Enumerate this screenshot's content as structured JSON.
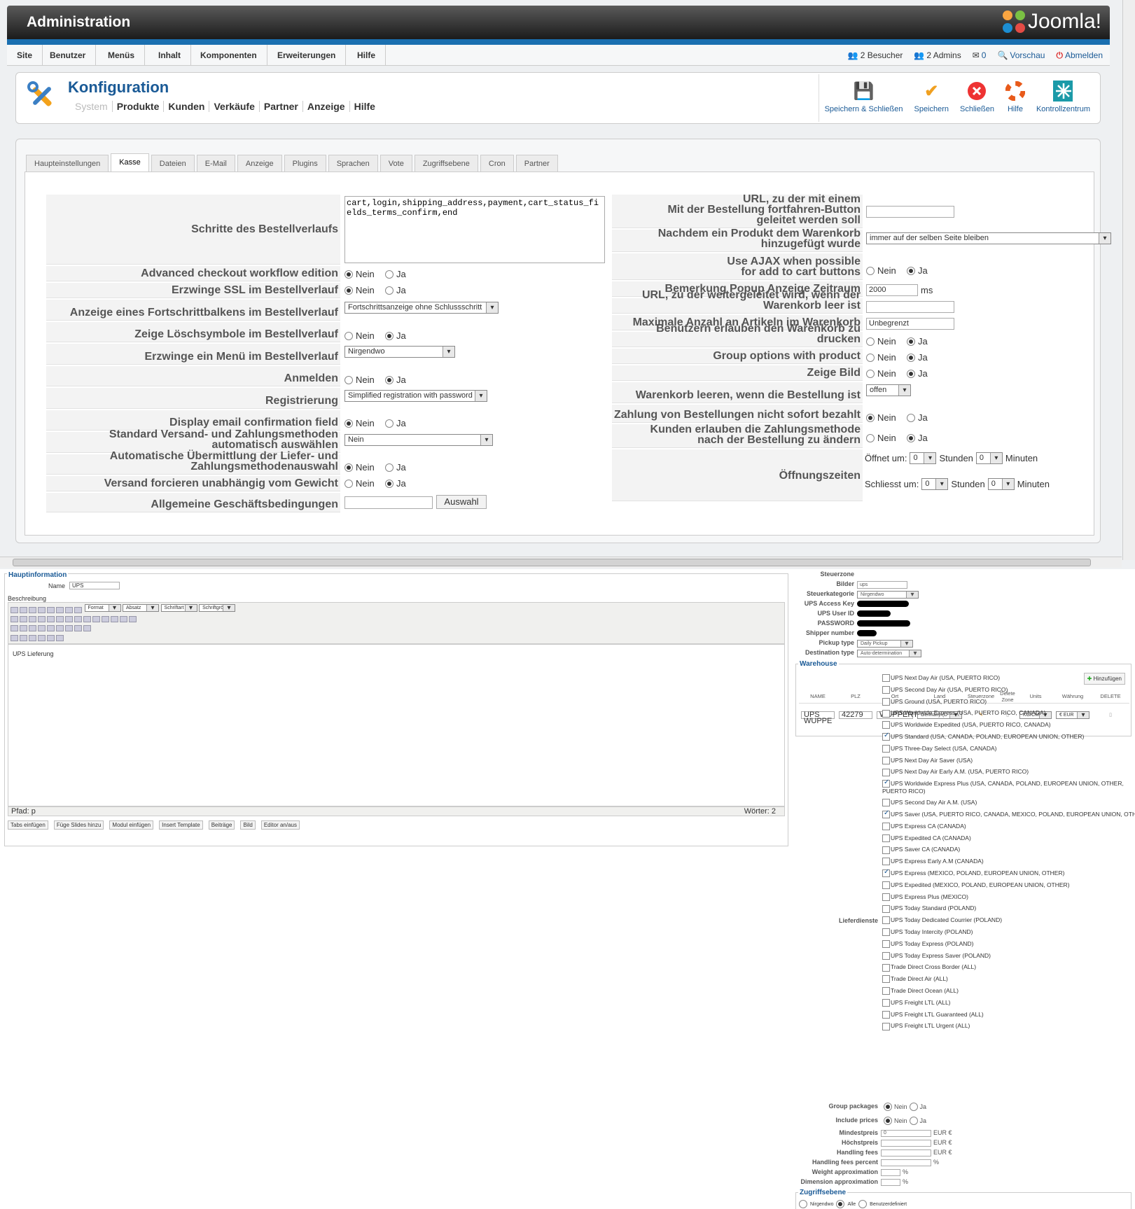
{
  "header": {
    "title": "Administration",
    "logo": "Joomla!"
  },
  "menu": {
    "items": [
      "Site",
      "Benutzer",
      "Menüs",
      "Inhalt",
      "Komponenten",
      "Erweiterungen",
      "Hilfe"
    ],
    "status": {
      "visitors": "2 Besucher",
      "admins": "2 Admins",
      "messages": "0",
      "preview": "Vorschau",
      "logout": "Abmelden"
    }
  },
  "page": {
    "title": "Konfiguration",
    "submenu": [
      "System",
      "Produkte",
      "Kunden",
      "Verkäufe",
      "Partner",
      "Anzeige",
      "Hilfe"
    ]
  },
  "toolbar": {
    "save_close": "Speichern & Schließen",
    "save": "Speichern",
    "close": "Schließen",
    "help": "Hilfe",
    "control": "Kontrollzentrum"
  },
  "tabs": [
    "Haupteinstellungen",
    "Kasse",
    "Dateien",
    "E-Mail",
    "Anzeige",
    "Plugins",
    "Sprachen",
    "Vote",
    "Zugriffsebene",
    "Cron",
    "Partner"
  ],
  "common": {
    "nein": "Nein",
    "ja": "Ja",
    "ms": "ms",
    "stunden": "Stunden",
    "minuten": "Minuten",
    "auswahl": "Auswahl"
  },
  "left": {
    "steps_label": "Schritte des Bestellverlaufs",
    "steps_value": "cart,login,shipping_address,payment,cart_status_fields_terms_confirm,end",
    "advanced": "Advanced checkout workflow edition",
    "ssl": "Erzwinge SSL im Bestellverlauf",
    "progress": "Anzeige eines Fortschrittbalkens im Bestellverlauf",
    "progress_value": "Fortschrittsanzeige ohne Schlussschritt",
    "delete_icons": "Zeige Löschsymbole im Bestellverlauf",
    "menu": "Erzwinge ein Menü im Bestellverlauf",
    "menu_value": "Nirgendwo",
    "login": "Anmelden",
    "registration": "Registrierung",
    "registration_value": "Simplified registration with password",
    "email_confirm": "Display email confirmation field",
    "auto_select": "Standard Versand- und Zahlungsmethoden automatisch auswählen",
    "auto_select_value": "Nein",
    "auto_submit": "Automatische Übermittlung der Liefer- und Zahlungsmethodenauswahl",
    "force_ship": "Versand forcieren unabhängig vom Gewicht",
    "terms": "Allgemeine Geschäftsbedingungen"
  },
  "right": {
    "url_continue": [
      "URL, zu der mit einem",
      "Mit der Bestellung fortfahren-Button",
      "geleitet werden soll"
    ],
    "after_add": "Nachdem ein Produkt dem Warenkorb hinzugefügt wurde",
    "after_add_value": "immer auf der selben Seite bleiben",
    "ajax": [
      "Use AJAX when possible",
      "for add to cart buttons"
    ],
    "popup": "Bemerkung Popup Anzeige Zeitraum",
    "popup_value": "2000",
    "url_empty": "URL, zu der weitergeleitet wird, wenn der Warenkorb leer ist",
    "max_items": "Maximale Anzahl an Artikeln im Warenkorb",
    "max_items_value": "Unbegrenzt",
    "print": "Benutzern erlauben den Warenkorb zu drucken",
    "group_options": "Group options with product",
    "show_image": "Zeige Bild",
    "empty_cart": "Warenkorb leeren, wenn die Bestellung ist",
    "empty_cart_value": "offen",
    "pay_later": "Zahlung von Bestellungen nicht sofort bezahlt",
    "change_pay": [
      "Kunden erlauben die Zahlungsmethode",
      "nach der Bestellung zu ändern"
    ],
    "hours": "Öffnungszeiten",
    "opens": "Öffnet um:",
    "closes": "Schliesst um:",
    "zero": "0"
  },
  "lower": {
    "legend": "Hauptinformation",
    "name_label": "Name",
    "name_value": "UPS",
    "desc_label": "Beschreibung",
    "editor_text": "UPS Lieferung",
    "path": "Pfad: p",
    "words": "Wörter: 2",
    "editor_combo": [
      "Format",
      "Absatz",
      "Schriftart",
      "Schriftgröße"
    ],
    "buttons": [
      "Tabs einfügen",
      "Füge Slides hinzu",
      "Modul einfügen",
      "Insert Template",
      "Beiträge",
      "Bild",
      "Editor an/aus"
    ],
    "side": {
      "steuerzone": "Steuerzone",
      "bilder": "Bilder",
      "bilder_value": "ups",
      "steuerkat": "Steuerkategorie",
      "steuerkat_value": "Nirgendwo",
      "access": "UPS Access Key",
      "user": "UPS User ID",
      "pw": "PASSWORD",
      "shipper": "Shipper number",
      "pickup": "Pickup type",
      "pickup_value": "Daily Pickup",
      "dest": "Destination type",
      "dest_value": "Auto-determination"
    },
    "warehouse": {
      "legend": "Warehouse",
      "add": "Hinzufügen",
      "cols": [
        "NAME",
        "PLZ",
        "Ort",
        "Land",
        "Steuerzone",
        "Delete Zone",
        "Units",
        "Währung",
        "DELETE"
      ],
      "row": [
        "UPS WUPPE",
        "42279",
        "WUPPERTA",
        "Germany (D",
        "",
        "",
        "KG/CM",
        "€ EUR",
        ""
      ]
    },
    "services_label": "Lieferdienste",
    "services": [
      {
        "t": "UPS Next Day Air (USA, PUERTO RICO)",
        "c": false
      },
      {
        "t": "UPS Second Day Air (USA, PUERTO RICO)",
        "c": false
      },
      {
        "t": "UPS Ground (USA, PUERTO RICO)",
        "c": false
      },
      {
        "t": "UPS Worldwide Express (USA, PUERTO RICO, CANADA)",
        "c": false
      },
      {
        "t": "UPS Worldwide Expedited (USA, PUERTO RICO, CANADA)",
        "c": false
      },
      {
        "t": "UPS Standard (USA, CANADA, POLAND, EUROPEAN UNION, OTHER)",
        "c": true
      },
      {
        "t": "UPS Three-Day Select (USA, CANADA)",
        "c": false
      },
      {
        "t": "UPS Next Day Air Saver (USA)",
        "c": false
      },
      {
        "t": "UPS Next Day Air Early A.M. (USA, PUERTO RICO)",
        "c": false
      },
      {
        "t": "UPS Worldwide Express Plus (USA, CANADA, POLAND, EUROPEAN UNION, OTHER, PUERTO RICO)",
        "c": true
      },
      {
        "t": "UPS Second Day Air A.M. (USA)",
        "c": false
      },
      {
        "t": "UPS Saver (USA, PUERTO RICO, CANADA, MEXICO, POLAND, EUROPEAN UNION, OTHER)",
        "c": true
      },
      {
        "t": "UPS Express CA (CANADA)",
        "c": false
      },
      {
        "t": "UPS Expedited CA (CANADA)",
        "c": false
      },
      {
        "t": "UPS Saver CA (CANADA)",
        "c": false
      },
      {
        "t": "UPS Express Early A.M (CANADA)",
        "c": false
      },
      {
        "t": "UPS Express (MEXICO, POLAND, EUROPEAN UNION, OTHER)",
        "c": true
      },
      {
        "t": "UPS Expedited (MEXICO, POLAND, EUROPEAN UNION, OTHER)",
        "c": false
      },
      {
        "t": "UPS Express Plus (MEXICO)",
        "c": false
      },
      {
        "t": "UPS Today Standard (POLAND)",
        "c": false
      },
      {
        "t": "UPS Today Dedicated Courrier (POLAND)",
        "c": false
      },
      {
        "t": "UPS Today Intercity (POLAND)",
        "c": false
      },
      {
        "t": "UPS Today Express (POLAND)",
        "c": false
      },
      {
        "t": "UPS Today Express Saver (POLAND)",
        "c": false
      },
      {
        "t": "Trade Direct Cross Border (ALL)",
        "c": false
      },
      {
        "t": "Trade Direct Air (ALL)",
        "c": false
      },
      {
        "t": "Trade Direct Ocean (ALL)",
        "c": false
      },
      {
        "t": "UPS Freight LTL (ALL)",
        "c": false
      },
      {
        "t": "UPS Freight LTL Guaranteed (ALL)",
        "c": false
      },
      {
        "t": "UPS Freight LTL Urgent (ALL)",
        "c": false
      }
    ],
    "group_packages": "Group packages",
    "include_prices": "Include prices",
    "min": "Mindestpreis",
    "min_value": "0",
    "max": "Höchstpreis",
    "handling": "Handling fees",
    "handling_pct": "Handling fees percent",
    "weight": "Weight approximation",
    "dimension": "Dimension approximation",
    "eur": "EUR €",
    "pct": "%",
    "access_legend": "Zugriffsebene",
    "access_opts": [
      "Nirgendwo",
      "Alle",
      "Benutzerdefiniert"
    ]
  }
}
